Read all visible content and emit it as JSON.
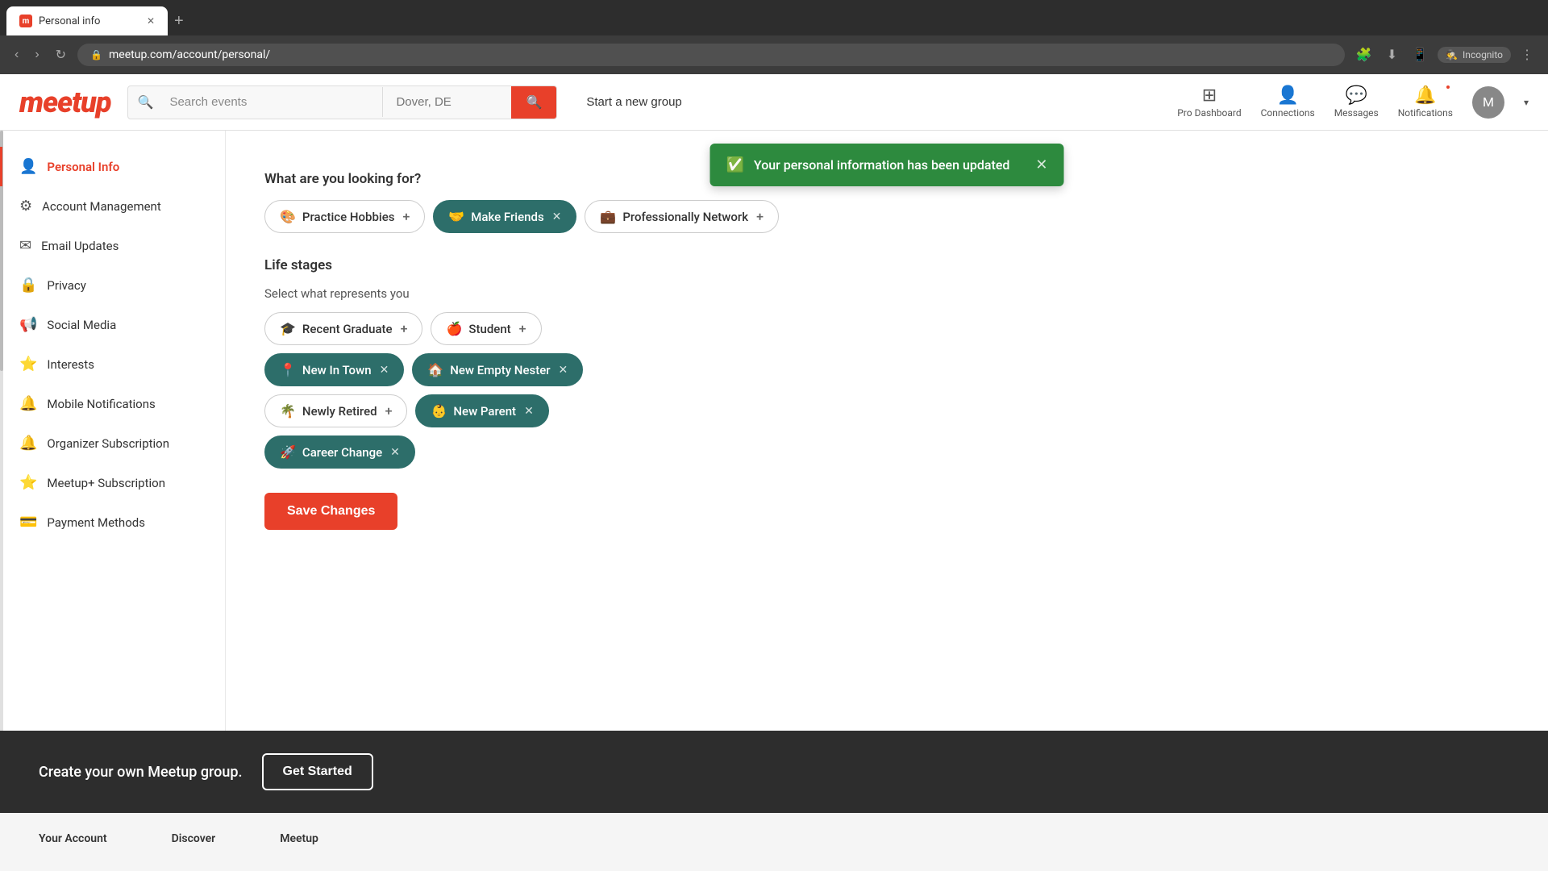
{
  "browser": {
    "tab_title": "Personal info",
    "tab_favicon": "m",
    "address": "meetup.com/account/personal/",
    "nav_new_tab_label": "+",
    "incognito_label": "Incognito"
  },
  "topnav": {
    "logo": "meetup",
    "search_placeholder": "Search events",
    "location_value": "Dover, DE",
    "start_group_label": "Start a new group",
    "nav_items": [
      {
        "id": "pro-dashboard",
        "icon": "⊞",
        "label": "Pro Dashboard"
      },
      {
        "id": "connections",
        "icon": "👤",
        "label": "Connections"
      },
      {
        "id": "messages",
        "icon": "💬",
        "label": "Messages"
      },
      {
        "id": "notifications",
        "icon": "🔔",
        "label": "Notifications",
        "has_dot": true
      }
    ]
  },
  "sidebar": {
    "items": [
      {
        "id": "personal-info",
        "icon": "👤",
        "label": "Personal Info",
        "active": true
      },
      {
        "id": "account-management",
        "icon": "⚙",
        "label": "Account Management",
        "active": false
      },
      {
        "id": "email-updates",
        "icon": "✉",
        "label": "Email Updates",
        "active": false
      },
      {
        "id": "privacy",
        "icon": "🔒",
        "label": "Privacy",
        "active": false
      },
      {
        "id": "social-media",
        "icon": "📢",
        "label": "Social Media",
        "active": false
      },
      {
        "id": "interests",
        "icon": "⭐",
        "label": "Interests",
        "active": false
      },
      {
        "id": "mobile-notifications",
        "icon": "🔔",
        "label": "Mobile Notifications",
        "active": false
      },
      {
        "id": "organizer-subscription",
        "icon": "🔔",
        "label": "Organizer Subscription",
        "active": false
      },
      {
        "id": "meetup-plus",
        "icon": "⭐",
        "label": "Meetup+ Subscription",
        "active": false
      },
      {
        "id": "payment-methods",
        "icon": "💳",
        "label": "Payment Methods",
        "active": false
      }
    ]
  },
  "notification": {
    "message": "Your personal information has been updated",
    "type": "success"
  },
  "content": {
    "looking_for_title": "What are you looking for?",
    "looking_for_tags": [
      {
        "id": "practice-hobbies",
        "emoji": "🎨",
        "label": "Practice Hobbies",
        "selected": false
      },
      {
        "id": "make-friends",
        "emoji": "🤝",
        "label": "Make Friends",
        "selected": true
      },
      {
        "id": "professionally-network",
        "emoji": "💼",
        "label": "Professionally Network",
        "selected": false
      }
    ],
    "life_stages_title": "Life stages",
    "life_stages_subtitle": "Select what represents you",
    "life_stage_tags": [
      {
        "id": "recent-graduate",
        "emoji": "🎓",
        "label": "Recent Graduate",
        "selected": false
      },
      {
        "id": "student",
        "emoji": "🍎",
        "label": "Student",
        "selected": false
      },
      {
        "id": "new-in-town",
        "emoji": "📍",
        "label": "New In Town",
        "selected": true
      },
      {
        "id": "new-empty-nester",
        "emoji": "🏠",
        "label": "New Empty Nester",
        "selected": true
      },
      {
        "id": "newly-retired",
        "emoji": "🌴",
        "label": "Newly Retired",
        "selected": false
      },
      {
        "id": "new-parent",
        "emoji": "👶",
        "label": "New Parent",
        "selected": true
      },
      {
        "id": "career-change",
        "emoji": "🚀",
        "label": "Career Change",
        "selected": true
      }
    ],
    "save_label": "Save Changes"
  },
  "footer": {
    "cta_text": "Create your own Meetup group.",
    "get_started_label": "Get Started",
    "col1_title": "Your Account",
    "col2_title": "Discover",
    "col3_title": "Meetup"
  }
}
